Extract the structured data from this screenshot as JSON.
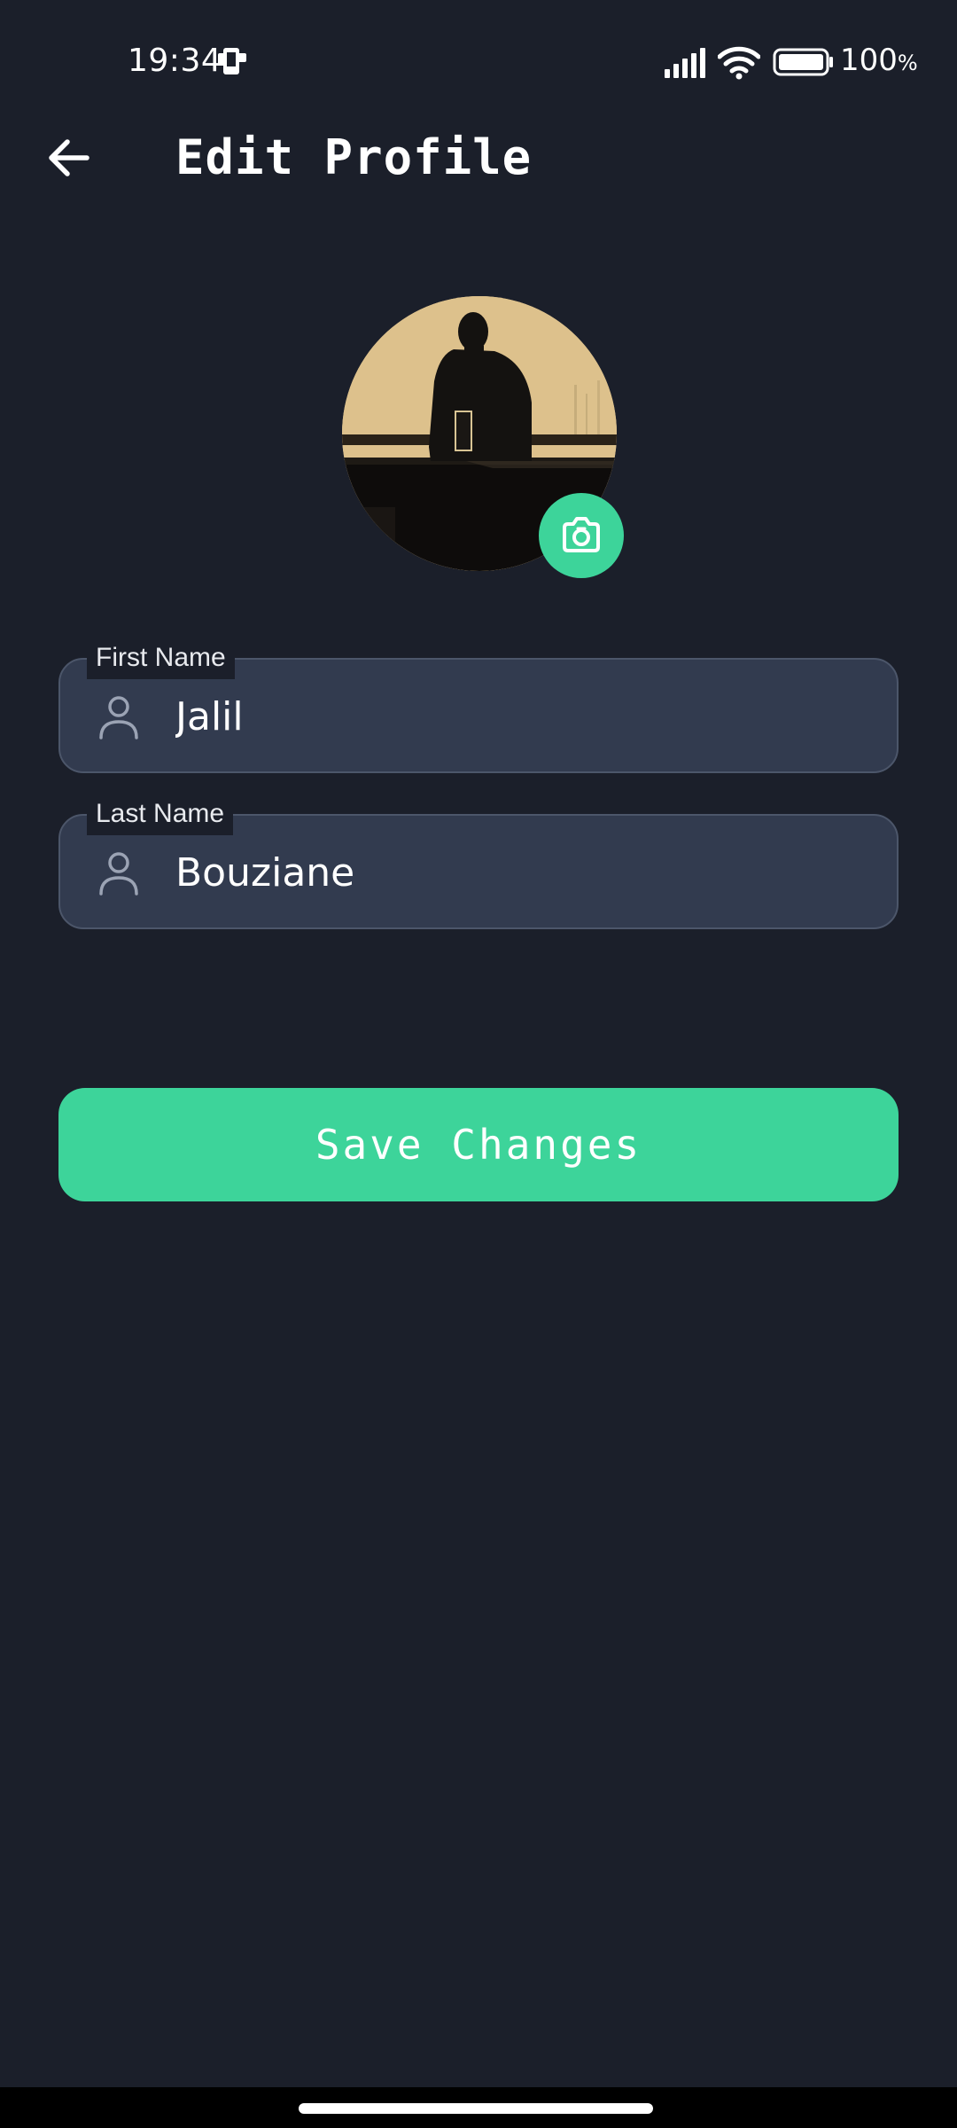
{
  "status_bar": {
    "time": "19:34",
    "battery_percent": "100",
    "battery_unit": "%",
    "icons": [
      "notification-icon",
      "signal-icon",
      "wifi-icon",
      "battery-icon"
    ]
  },
  "header": {
    "back_icon": "arrow-left-icon",
    "title": "Edit Profile"
  },
  "avatar": {
    "camera_icon": "camera-icon"
  },
  "form": {
    "first_name": {
      "label": "First Name",
      "value": "Jalil",
      "icon": "person-icon"
    },
    "last_name": {
      "label": "Last Name",
      "value": "Bouziane",
      "icon": "person-icon"
    }
  },
  "actions": {
    "save_label": "Save Changes"
  },
  "colors": {
    "background": "#1b1f2a",
    "field_background": "#323b4f",
    "accent": "#3dd49a"
  }
}
